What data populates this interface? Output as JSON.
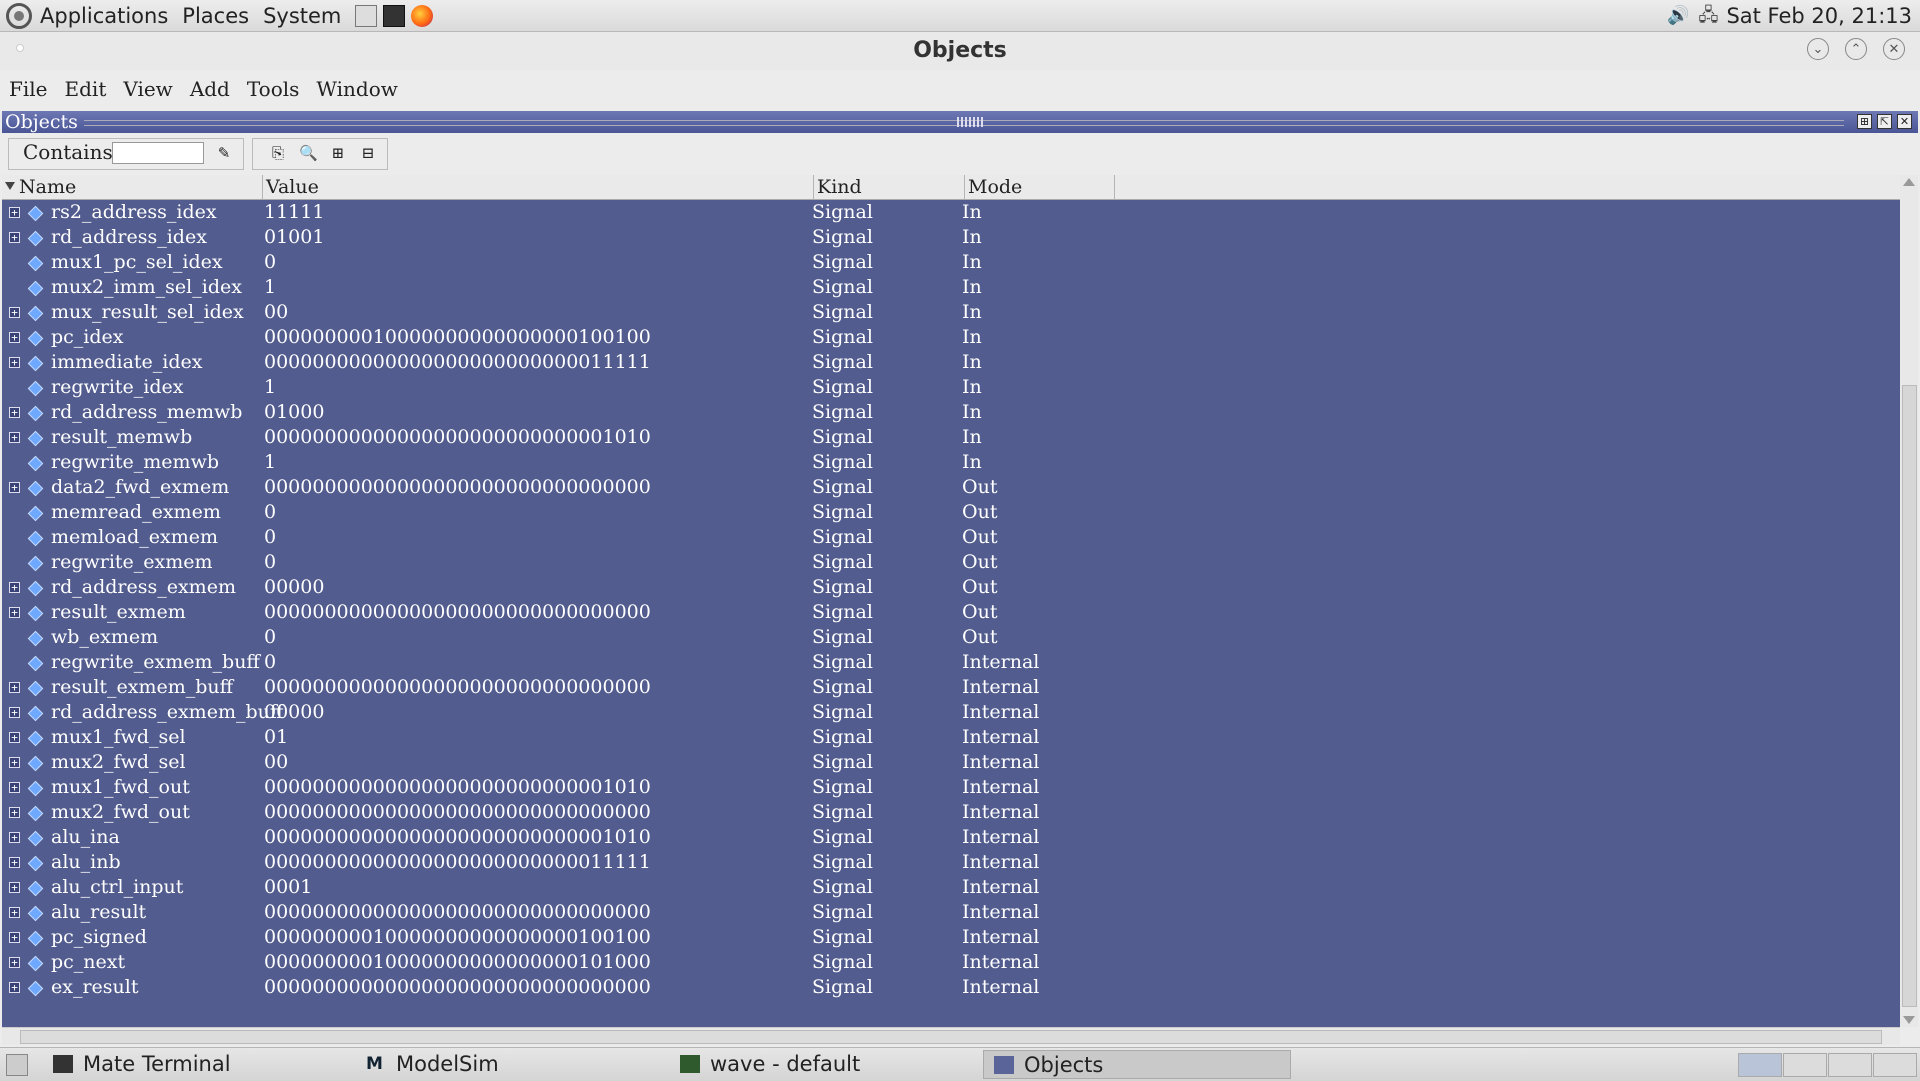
{
  "top_panel": {
    "menus": [
      "Applications",
      "Places",
      "System"
    ],
    "clock": "Sat Feb 20, 21:13"
  },
  "window": {
    "title": "Objects"
  },
  "menu_bar": [
    "File",
    "Edit",
    "View",
    "Add",
    "Tools",
    "Window"
  ],
  "pane": {
    "title": "Objects"
  },
  "toolbar": {
    "contains_label": "Contains",
    "contains_value": ""
  },
  "columns": {
    "name": "Name",
    "value": "Value",
    "kind": "Kind",
    "mode": "Mode"
  },
  "rows": [
    {
      "exp": true,
      "name": "rs2_address_idex",
      "value": "11111",
      "kind": "Signal",
      "mode": "In"
    },
    {
      "exp": true,
      "name": "rd_address_idex",
      "value": "01001",
      "kind": "Signal",
      "mode": "In"
    },
    {
      "exp": false,
      "name": "mux1_pc_sel_idex",
      "value": "0",
      "kind": "Signal",
      "mode": "In"
    },
    {
      "exp": false,
      "name": "mux2_imm_sel_idex",
      "value": "1",
      "kind": "Signal",
      "mode": "In"
    },
    {
      "exp": true,
      "name": "mux_result_sel_idex",
      "value": "00",
      "kind": "Signal",
      "mode": "In"
    },
    {
      "exp": true,
      "name": "pc_idex",
      "value": "00000000010000000000000000100100",
      "kind": "Signal",
      "mode": "In"
    },
    {
      "exp": true,
      "name": "immediate_idex",
      "value": "00000000000000000000000000011111",
      "kind": "Signal",
      "mode": "In"
    },
    {
      "exp": false,
      "name": "regwrite_idex",
      "value": "1",
      "kind": "Signal",
      "mode": "In"
    },
    {
      "exp": true,
      "name": "rd_address_memwb",
      "value": "01000",
      "kind": "Signal",
      "mode": "In"
    },
    {
      "exp": true,
      "name": "result_memwb",
      "value": "00000000000000000000000000001010",
      "kind": "Signal",
      "mode": "In"
    },
    {
      "exp": false,
      "name": "regwrite_memwb",
      "value": "1",
      "kind": "Signal",
      "mode": "In"
    },
    {
      "exp": true,
      "name": "data2_fwd_exmem",
      "value": "00000000000000000000000000000000",
      "kind": "Signal",
      "mode": "Out"
    },
    {
      "exp": false,
      "name": "memread_exmem",
      "value": "0",
      "kind": "Signal",
      "mode": "Out"
    },
    {
      "exp": false,
      "name": "memload_exmem",
      "value": "0",
      "kind": "Signal",
      "mode": "Out"
    },
    {
      "exp": false,
      "name": "regwrite_exmem",
      "value": "0",
      "kind": "Signal",
      "mode": "Out"
    },
    {
      "exp": true,
      "name": "rd_address_exmem",
      "value": "00000",
      "kind": "Signal",
      "mode": "Out"
    },
    {
      "exp": true,
      "name": "result_exmem",
      "value": "00000000000000000000000000000000",
      "kind": "Signal",
      "mode": "Out"
    },
    {
      "exp": false,
      "name": "wb_exmem",
      "value": "0",
      "kind": "Signal",
      "mode": "Out"
    },
    {
      "exp": false,
      "name": "regwrite_exmem_buff",
      "value": "0",
      "kind": "Signal",
      "mode": "Internal"
    },
    {
      "exp": true,
      "name": "result_exmem_buff",
      "value": "00000000000000000000000000000000",
      "kind": "Signal",
      "mode": "Internal"
    },
    {
      "exp": true,
      "name": "rd_address_exmem_buff",
      "value": "00000",
      "kind": "Signal",
      "mode": "Internal"
    },
    {
      "exp": true,
      "name": "mux1_fwd_sel",
      "value": "01",
      "kind": "Signal",
      "mode": "Internal"
    },
    {
      "exp": true,
      "name": "mux2_fwd_sel",
      "value": "00",
      "kind": "Signal",
      "mode": "Internal"
    },
    {
      "exp": true,
      "name": "mux1_fwd_out",
      "value": "00000000000000000000000000001010",
      "kind": "Signal",
      "mode": "Internal"
    },
    {
      "exp": true,
      "name": "mux2_fwd_out",
      "value": "00000000000000000000000000000000",
      "kind": "Signal",
      "mode": "Internal"
    },
    {
      "exp": true,
      "name": "alu_ina",
      "value": "00000000000000000000000000001010",
      "kind": "Signal",
      "mode": "Internal"
    },
    {
      "exp": true,
      "name": "alu_inb",
      "value": "00000000000000000000000000011111",
      "kind": "Signal",
      "mode": "Internal"
    },
    {
      "exp": true,
      "name": "alu_ctrl_input",
      "value": "0001",
      "kind": "Signal",
      "mode": "Internal"
    },
    {
      "exp": true,
      "name": "alu_result",
      "value": "00000000000000000000000000000000",
      "kind": "Signal",
      "mode": "Internal"
    },
    {
      "exp": true,
      "name": "pc_signed",
      "value": "00000000010000000000000000100100",
      "kind": "Signal",
      "mode": "Internal"
    },
    {
      "exp": true,
      "name": "pc_next",
      "value": "00000000010000000000000000101000",
      "kind": "Signal",
      "mode": "Internal"
    },
    {
      "exp": true,
      "name": "ex_result",
      "value": "00000000000000000000000000000000",
      "kind": "Signal",
      "mode": "Internal"
    }
  ],
  "taskbar": [
    "Mate Terminal",
    "ModelSim",
    "wave - default",
    "Objects"
  ],
  "colors": {
    "list_bg": "#525c8e",
    "pane_header": "#4a5596",
    "signal_icon": "#6fa8ff"
  }
}
